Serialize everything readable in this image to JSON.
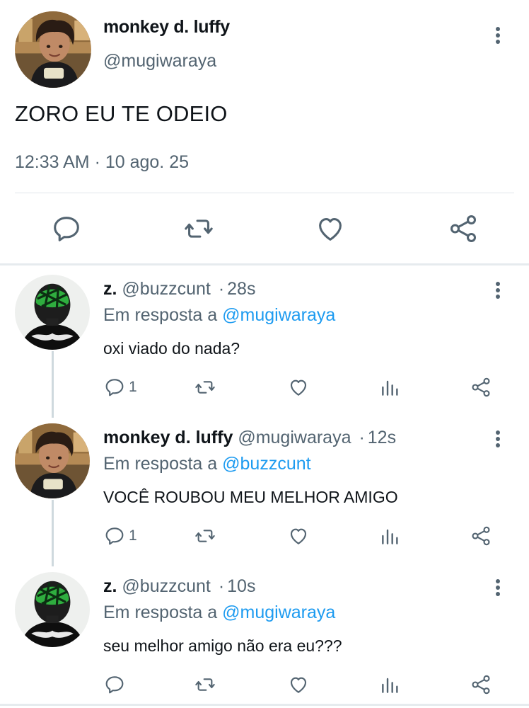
{
  "main_tweet": {
    "name": "monkey d. luffy",
    "handle": "@mugiwaraya",
    "text": "ZORO EU TE ODEIO",
    "timestamp": "12:33 AM · 10 ago. 25",
    "actions": [
      "reply-icon",
      "retweet-icon",
      "like-icon",
      "share-icon"
    ]
  },
  "replies": [
    {
      "name": "z.",
      "handle": "@buzzcunt",
      "dot": "·",
      "time": "28s",
      "replying_prefix": "Em resposta a",
      "replying_to": "@mugiwaraya",
      "text": "oxi viado do nada?",
      "reply_count": "1"
    },
    {
      "name": "monkey d. luffy",
      "handle": "@mugiwaraya",
      "dot": "·",
      "time": "12s",
      "replying_prefix": "Em resposta a",
      "replying_to": "@buzzcunt",
      "text": "VOCÊ ROUBOU MEU MELHOR AMIGO",
      "reply_count": "1"
    },
    {
      "name": "z.",
      "handle": "@buzzcunt",
      "dot": "·",
      "time": "10s",
      "replying_prefix": "Em resposta a",
      "replying_to": "@mugiwaraya",
      "text": "seu melhor amigo não era eu???",
      "reply_count": ""
    }
  ],
  "colors": {
    "text": "#0f1419",
    "secondary": "#536471",
    "link": "#1d9bf0",
    "divider": "#e1e6ea"
  }
}
